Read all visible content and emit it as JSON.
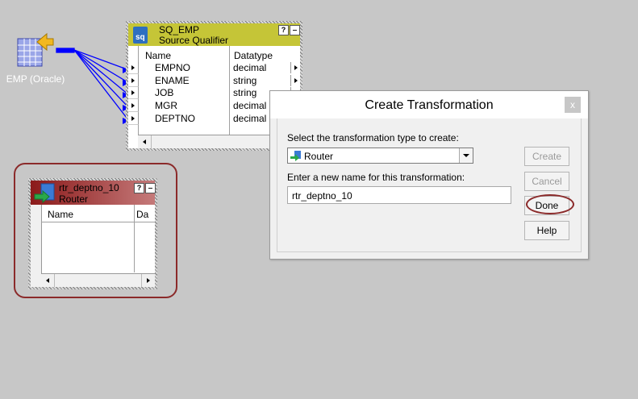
{
  "source": {
    "label": "EMP (Oracle)"
  },
  "source_qualifier": {
    "name": "SQ_EMP",
    "type": "Source Qualifier",
    "help_btn": "?",
    "min_btn": "‒",
    "columns": [
      "Name",
      "Datatype"
    ],
    "rows": [
      {
        "name": "EMPNO",
        "datatype": "decimal"
      },
      {
        "name": "ENAME",
        "datatype": "string"
      },
      {
        "name": "JOB",
        "datatype": "string"
      },
      {
        "name": "MGR",
        "datatype": "decimal"
      },
      {
        "name": "DEPTNO",
        "datatype": "decimal"
      }
    ]
  },
  "router": {
    "name": "rtr_deptno_10",
    "type": "Router",
    "help_btn": "?",
    "min_btn": "‒",
    "columns": [
      "Name",
      "Da"
    ]
  },
  "dialog": {
    "title": "Create Transformation",
    "close": "x",
    "type_label": "Select the transformation type to create:",
    "type_value": "Router",
    "name_label": "Enter a new name for this transformation:",
    "name_value": "rtr_deptno_10",
    "buttons": {
      "create": "Create",
      "cancel": "Cancel",
      "done": "Done",
      "help": "Help"
    }
  },
  "colors": {
    "qualifier_title": "#c5c537",
    "router_title": "#8b1a1a",
    "link": "#0000ff",
    "highlight_ring": "#8b2a2a"
  }
}
